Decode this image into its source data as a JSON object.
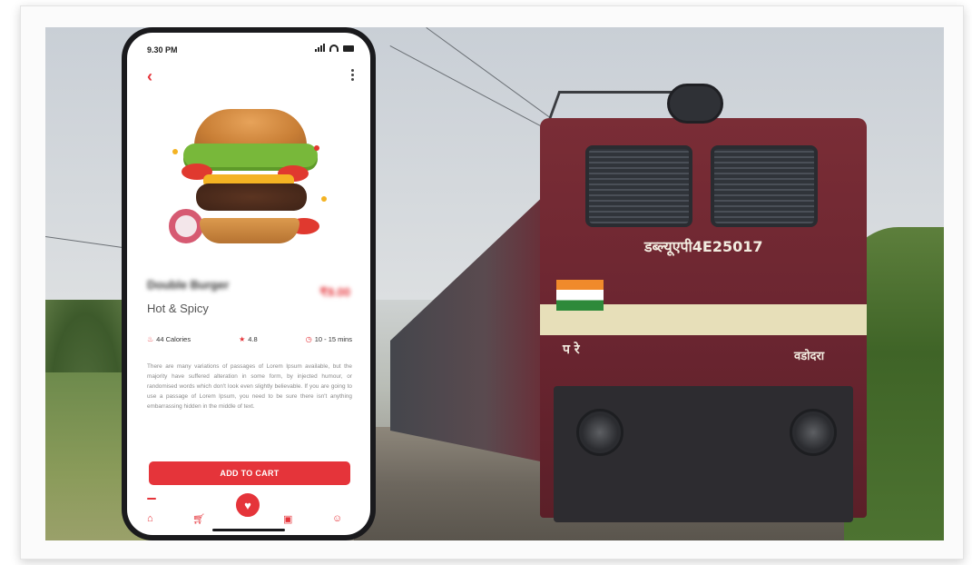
{
  "phone": {
    "status_time": "9.30 PM",
    "product_name": "Double Burger",
    "price": "₹9.00",
    "subtitle": "Hot & Spicy",
    "stats": {
      "calories": "44 Calories",
      "rating": "4.8",
      "time": "10 - 15 mins"
    },
    "description": "There are many variations of passages of Lorem Ipsum available, but the majority have suffered alteration in some form, by injected humour, or randomised words which don't look even slightly believable. If you are going to use a passage of Lorem Ipsum, you need to be sure there isn't anything embarrassing hidden in the middle of text.",
    "cta_label": "ADD TO CART",
    "accent_color": "#e5343a",
    "icons": [
      "back-chevron-icon",
      "more-vertical-icon",
      "flame-icon",
      "star-icon",
      "clock-icon",
      "home-icon",
      "cart-icon",
      "heart-icon",
      "bag-icon",
      "user-icon"
    ]
  },
  "background": {
    "loco_number": "डब्ल्यूएपी4E25017",
    "loco_left_text": "प रे",
    "loco_right_text": "वडोदरा"
  }
}
